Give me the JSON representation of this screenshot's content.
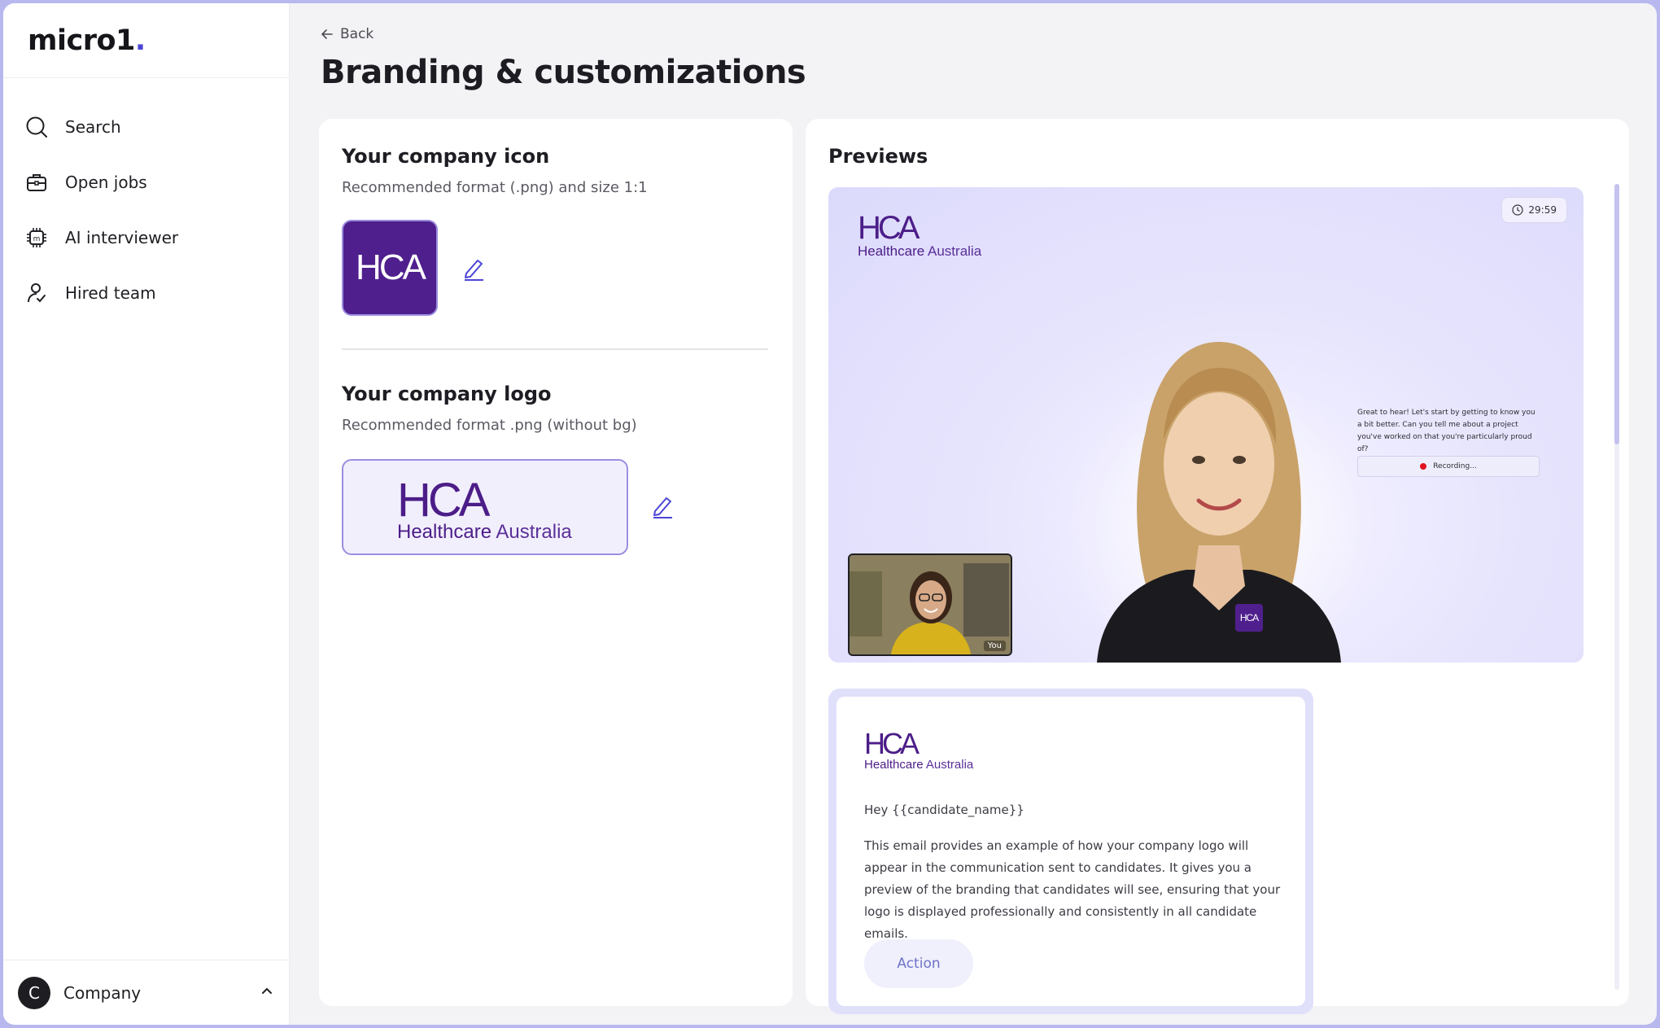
{
  "sidebar": {
    "brand": "micro1",
    "brand_dot": ".",
    "items": [
      {
        "label": "Search",
        "icon": "search-icon"
      },
      {
        "label": "Open jobs",
        "icon": "briefcase-icon"
      },
      {
        "label": "AI interviewer",
        "icon": "chip-icon"
      },
      {
        "label": "Hired team",
        "icon": "user-check-icon"
      }
    ],
    "company": {
      "avatar_letter": "C",
      "name": "Company"
    }
  },
  "header": {
    "back_label": "Back",
    "title": "Branding & customizations"
  },
  "icon_section": {
    "title": "Your company icon",
    "subtitle": "Recommended format (.png) and size 1:1",
    "icon_text": "HCA"
  },
  "logo_section": {
    "title": "Your company logo",
    "subtitle": "Recommended format .png (without bg)",
    "logo_big": "HCA",
    "logo_word1": "Healthcare",
    "logo_word2": "Australia"
  },
  "previews": {
    "title": "Previews",
    "video": {
      "timer": "29:59",
      "question": "Great to hear! Let's start by getting to know you a bit better. Can you tell me about a project you've worked on that you're particularly proud of?",
      "recording": "Recording...",
      "self_label": "You",
      "badge": "HCA"
    },
    "email": {
      "greeting": "Hey {{candidate_name}}",
      "body": "This email provides an example of how your company logo will appear in the communication sent to candidates. It gives you a preview of the branding that candidates will see, ensuring that your logo is displayed professionally and consistently in all candidate emails.",
      "action": "Action"
    }
  },
  "colors": {
    "brand_purple": "#4f1f8d",
    "accent": "#4b45d6",
    "frame": "#b9b8ee"
  }
}
